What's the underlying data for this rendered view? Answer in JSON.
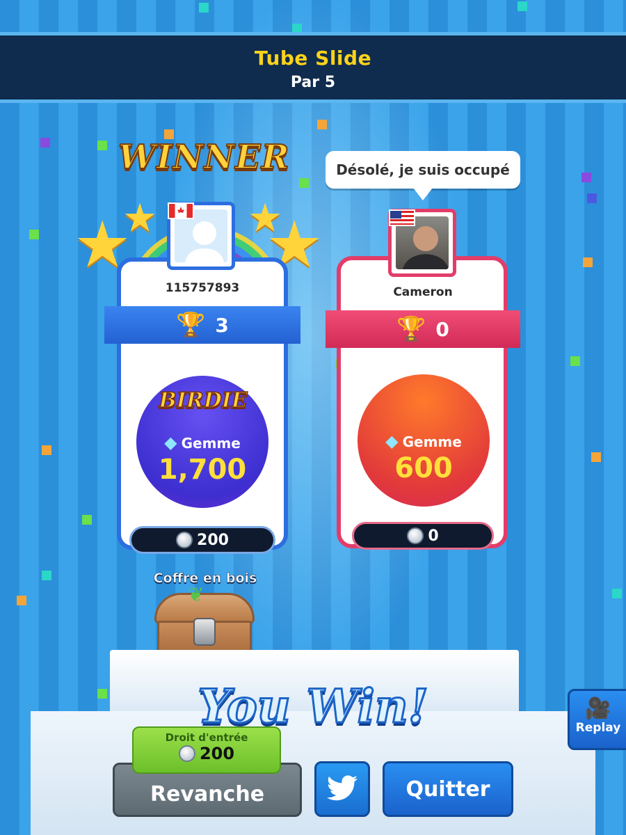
{
  "header": {
    "title": "Tube Slide",
    "subtitle": "Par 5"
  },
  "winner_banner": "WINNER",
  "result": "You Win!",
  "players": [
    {
      "name": "115757893",
      "country_flag": "canada-flag",
      "trophies": "3",
      "bonus_label": "BIRDIE",
      "gem_label": "Gemme",
      "gem_value": "1,700",
      "coins": "200",
      "accent_color": "#2c6ee0"
    },
    {
      "name": "Cameron",
      "country_flag": "usa-flag",
      "trophies": "0",
      "speech_bubble": "Désolé, je suis occupé",
      "gem_label": "Gemme",
      "gem_value": "600",
      "coins": "0",
      "accent_color": "#e23d6a"
    }
  ],
  "reward": {
    "label": "Coffre en bois",
    "icon": "wooden-chest-icon"
  },
  "entry_fee": {
    "label": "Droit d'entrée",
    "value": "200"
  },
  "buttons": {
    "rematch": "Revanche",
    "quit": "Quitter",
    "replay": "Replay",
    "twitter_icon": "twitter-bird-icon"
  },
  "colors": {
    "header_bg": "#0f2c4e",
    "title": "#ffd21a",
    "gem_value": "#ffe03a"
  }
}
